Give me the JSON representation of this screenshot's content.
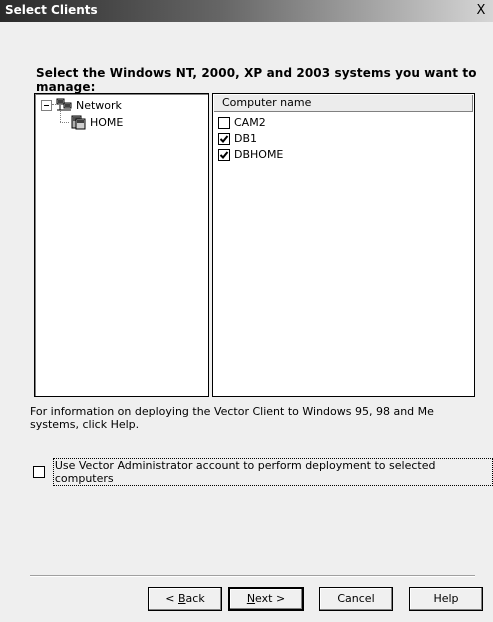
{
  "window": {
    "title": "Select Clients",
    "close_glyph": "X"
  },
  "heading": "Select the Windows NT, 2000, XP and 2003 systems you want to manage:",
  "tree": {
    "root": {
      "label": "Network",
      "icon": "network-icon",
      "expander": "minus"
    },
    "child": {
      "label": "HOME",
      "icon": "workgroup-icon"
    }
  },
  "list": {
    "header": "Computer name",
    "items": [
      {
        "label": "CAM2",
        "checked": false
      },
      {
        "label": "DB1",
        "checked": true
      },
      {
        "label": "DBHOME",
        "checked": true
      }
    ]
  },
  "info_text": "For information on deploying the Vector Client to Windows 95, 98 and Me systems, click Help.",
  "deploy_checkbox": {
    "label": "Use Vector Administrator account to perform deployment to selected computers",
    "checked": false
  },
  "buttons": {
    "back": {
      "prefix": "< ",
      "accel": "B",
      "rest": "ack"
    },
    "next": {
      "accel": "N",
      "rest": "ext >"
    },
    "cancel": "Cancel",
    "help": "Help"
  }
}
